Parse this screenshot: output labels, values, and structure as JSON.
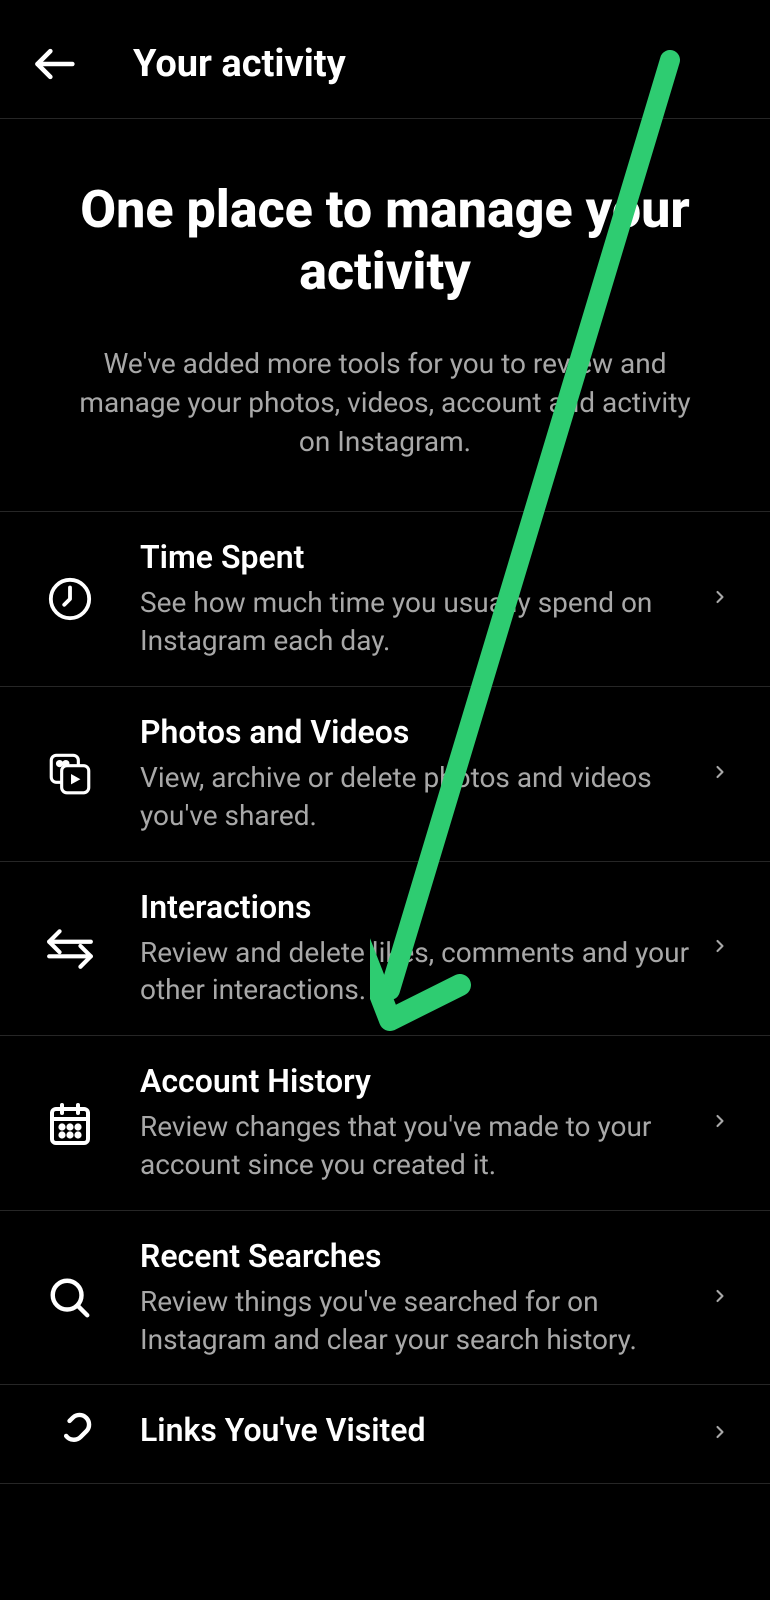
{
  "header": {
    "title": "Your activity"
  },
  "intro": {
    "title": "One place to manage your activity",
    "description": "We've added more tools for you to review and manage your photos, videos, account and activity on Instagram."
  },
  "items": [
    {
      "title": "Time Spent",
      "description": "See how much time you usually spend on Instagram each day."
    },
    {
      "title": "Photos and Videos",
      "description": "View, archive or delete photos and videos you've shared."
    },
    {
      "title": "Interactions",
      "description": "Review and delete likes, comments and your other interactions."
    },
    {
      "title": "Account History",
      "description": "Review changes that you've made to your account since you created it."
    },
    {
      "title": "Recent Searches",
      "description": "Review things you've searched for on Instagram and clear your search history."
    },
    {
      "title": "Links You've Visited",
      "description": ""
    }
  ]
}
